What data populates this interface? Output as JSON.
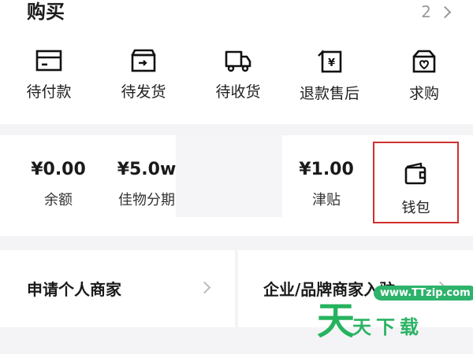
{
  "buy": {
    "title": "购买",
    "more_count": "2",
    "orders": [
      {
        "label": "待付款",
        "icon": "card-icon"
      },
      {
        "label": "待发货",
        "icon": "box-ship-icon"
      },
      {
        "label": "待收货",
        "icon": "truck-icon"
      },
      {
        "label": "退款售后",
        "icon": "refund-icon"
      },
      {
        "label": "求购",
        "icon": "heart-box-icon"
      }
    ]
  },
  "assets": {
    "balance": {
      "value": "¥0.00",
      "label": "余额"
    },
    "installment": {
      "value": "¥5.0w",
      "label": "佳物分期"
    },
    "subsidy": {
      "value": "¥1.00",
      "label": "津贴"
    },
    "wallet": {
      "label": "钱包",
      "icon": "wallet-icon"
    }
  },
  "merchant": {
    "personal": "申请个人商家",
    "enterprise": "企业/品牌商家入驻"
  },
  "watermark": {
    "url": "www.TTzip.com",
    "big_char": "天",
    "text": "天下载"
  },
  "colors": {
    "highlight_border": "#d0302e",
    "watermark_green": "#2db36b"
  }
}
